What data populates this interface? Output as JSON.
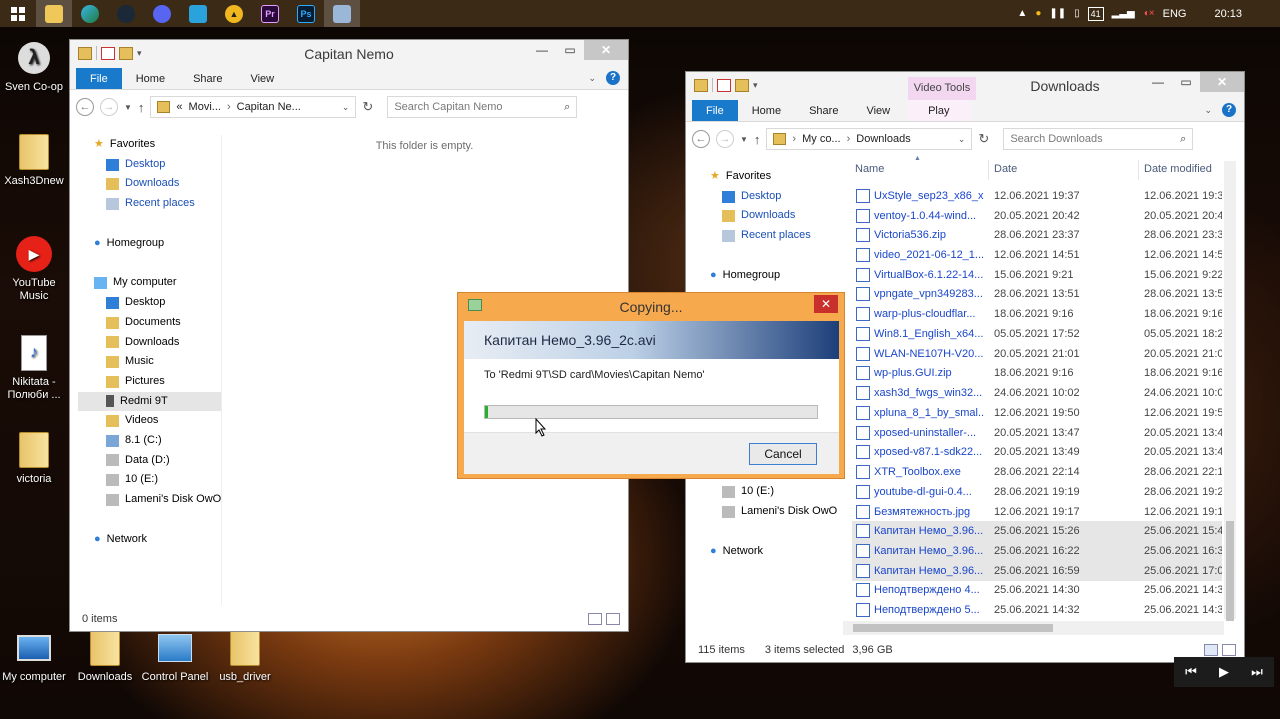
{
  "taskbar": {
    "buttons": [
      {
        "name": "start-button"
      },
      {
        "name": "file-explorer-button"
      },
      {
        "name": "edge-button"
      },
      {
        "name": "steam-button"
      },
      {
        "name": "discord-button"
      },
      {
        "name": "telegram-button"
      },
      {
        "name": "app-a-button"
      },
      {
        "name": "premiere-button",
        "label": "Pr"
      },
      {
        "name": "photoshop-button",
        "label": "Ps"
      },
      {
        "name": "copy-task-button"
      }
    ],
    "tray": {
      "battery_label": "41",
      "language": "ENG",
      "time": "20:13"
    }
  },
  "desktop": {
    "icons_left": [
      {
        "label": "Sven Co-op"
      },
      {
        "label": "Xash3Dnew"
      },
      {
        "label": "YouTube Music"
      },
      {
        "label": "Nikitata - Полюби ..."
      },
      {
        "label": "victoria"
      },
      {
        "label": "My computer"
      }
    ],
    "icons_bottom": [
      {
        "label": "Downloads"
      },
      {
        "label": "Control Panel"
      },
      {
        "label": "usb_driver"
      }
    ]
  },
  "window1": {
    "title": "Capitan Nemo",
    "ribbon_tabs": [
      "File",
      "Home",
      "Share",
      "View"
    ],
    "address": {
      "prefix": "«",
      "part1": "Movi...",
      "part2": "Capitan Ne..."
    },
    "search_placeholder": "Search Capitan Nemo",
    "empty_text": "This folder is empty.",
    "nav": {
      "favorites": "Favorites",
      "fav_items": [
        "Desktop",
        "Downloads",
        "Recent places"
      ],
      "homegroup": "Homegroup",
      "mycomputer": "My computer",
      "pc_items": [
        "Desktop",
        "Documents",
        "Downloads",
        "Music",
        "Pictures",
        "Redmi 9T",
        "Videos",
        "8.1 (C:)",
        "Data (D:)",
        "10 (E:)",
        "Lameni's Disk OwO"
      ],
      "network": "Network"
    },
    "status": "0 items"
  },
  "window2": {
    "title": "Downloads",
    "context_tab": "Video Tools",
    "ribbon_tabs": [
      "File",
      "Home",
      "Share",
      "View",
      "Play"
    ],
    "address": {
      "part1": "My co...",
      "part2": "Downloads"
    },
    "search_placeholder": "Search Downloads",
    "nav": {
      "favorites": "Favorites",
      "fav_items": [
        "Desktop",
        "Downloads",
        "Recent places"
      ],
      "homegroup": "Homegroup",
      "pc_items": [
        "Data (D:)",
        "10 (E:)",
        "Lameni's Disk OwO"
      ],
      "network": "Network"
    },
    "columns": {
      "name": "Name",
      "date": "Date",
      "modified": "Date modified"
    },
    "files": [
      {
        "name": "UxStyle_sep23_x86_x...",
        "date": "12.06.2021 19:37",
        "modified": "12.06.2021 19:37"
      },
      {
        "name": "ventoy-1.0.44-wind...",
        "date": "20.05.2021 20:42",
        "modified": "20.05.2021 20:42"
      },
      {
        "name": "Victoria536.zip",
        "date": "28.06.2021 23:37",
        "modified": "28.06.2021 23:37"
      },
      {
        "name": "video_2021-06-12_1...",
        "date": "12.06.2021 14:51",
        "modified": "12.06.2021 14:52"
      },
      {
        "name": "VirtualBox-6.1.22-14...",
        "date": "15.06.2021 9:21",
        "modified": "15.06.2021 9:22"
      },
      {
        "name": "vpngate_vpn349283...",
        "date": "28.06.2021 13:51",
        "modified": "28.06.2021 13:51"
      },
      {
        "name": "warp-plus-cloudflar...",
        "date": "18.06.2021 9:16",
        "modified": "18.06.2021 9:16"
      },
      {
        "name": "Win8.1_English_x64....",
        "date": "05.05.2021 17:52",
        "modified": "05.05.2021 18:27"
      },
      {
        "name": "WLAN-NE107H-V20...",
        "date": "20.05.2021 21:01",
        "modified": "20.05.2021 21:01"
      },
      {
        "name": "wp-plus.GUI.zip",
        "date": "18.06.2021 9:16",
        "modified": "18.06.2021 9:16"
      },
      {
        "name": "xash3d_fwgs_win32...",
        "date": "24.06.2021 10:02",
        "modified": "24.06.2021 10:02"
      },
      {
        "name": "xpluna_8_1_by_smal...",
        "date": "12.06.2021 19:50",
        "modified": "12.06.2021 19:50"
      },
      {
        "name": "xposed-uninstaller-...",
        "date": "20.05.2021 13:47",
        "modified": "20.05.2021 13:47"
      },
      {
        "name": "xposed-v87.1-sdk22...",
        "date": "20.05.2021 13:49",
        "modified": "20.05.2021 13:49"
      },
      {
        "name": "XTR_Toolbox.exe",
        "date": "28.06.2021 22:14",
        "modified": "28.06.2021 22:14"
      },
      {
        "name": "youtube-dl-gui-0.4...",
        "date": "28.06.2021 19:19",
        "modified": "28.06.2021 19:21"
      },
      {
        "name": "Безмятежность.jpg",
        "date": "12.06.2021 19:17",
        "modified": "12.06.2021 19:17"
      },
      {
        "name": "Капитан Немо_3.96...",
        "date": "25.06.2021 15:26",
        "modified": "25.06.2021 15:41",
        "selected": true
      },
      {
        "name": "Капитан Немо_3.96...",
        "date": "25.06.2021 16:22",
        "modified": "25.06.2021 16:34",
        "selected": true
      },
      {
        "name": "Капитан Немо_3.96...",
        "date": "25.06.2021 16:59",
        "modified": "25.06.2021 17:09",
        "selected": true
      },
      {
        "name": "Неподтверждено 4...",
        "date": "25.06.2021 14:30",
        "modified": "25.06.2021 14:30"
      },
      {
        "name": "Неподтверждено 5...",
        "date": "25.06.2021 14:32",
        "modified": "25.06.2021 14:32"
      }
    ],
    "status": {
      "count": "115 items",
      "selected": "3 items selected",
      "size": "3,96 GB"
    }
  },
  "copy_dialog": {
    "title": "Copying...",
    "filename": "Капитан Немо_3.96_2c.avi",
    "destination": "To 'Redmi 9T\\SD card\\Movies\\Capitan Nemo'",
    "progress": 0.01,
    "cancel_label": "Cancel"
  }
}
